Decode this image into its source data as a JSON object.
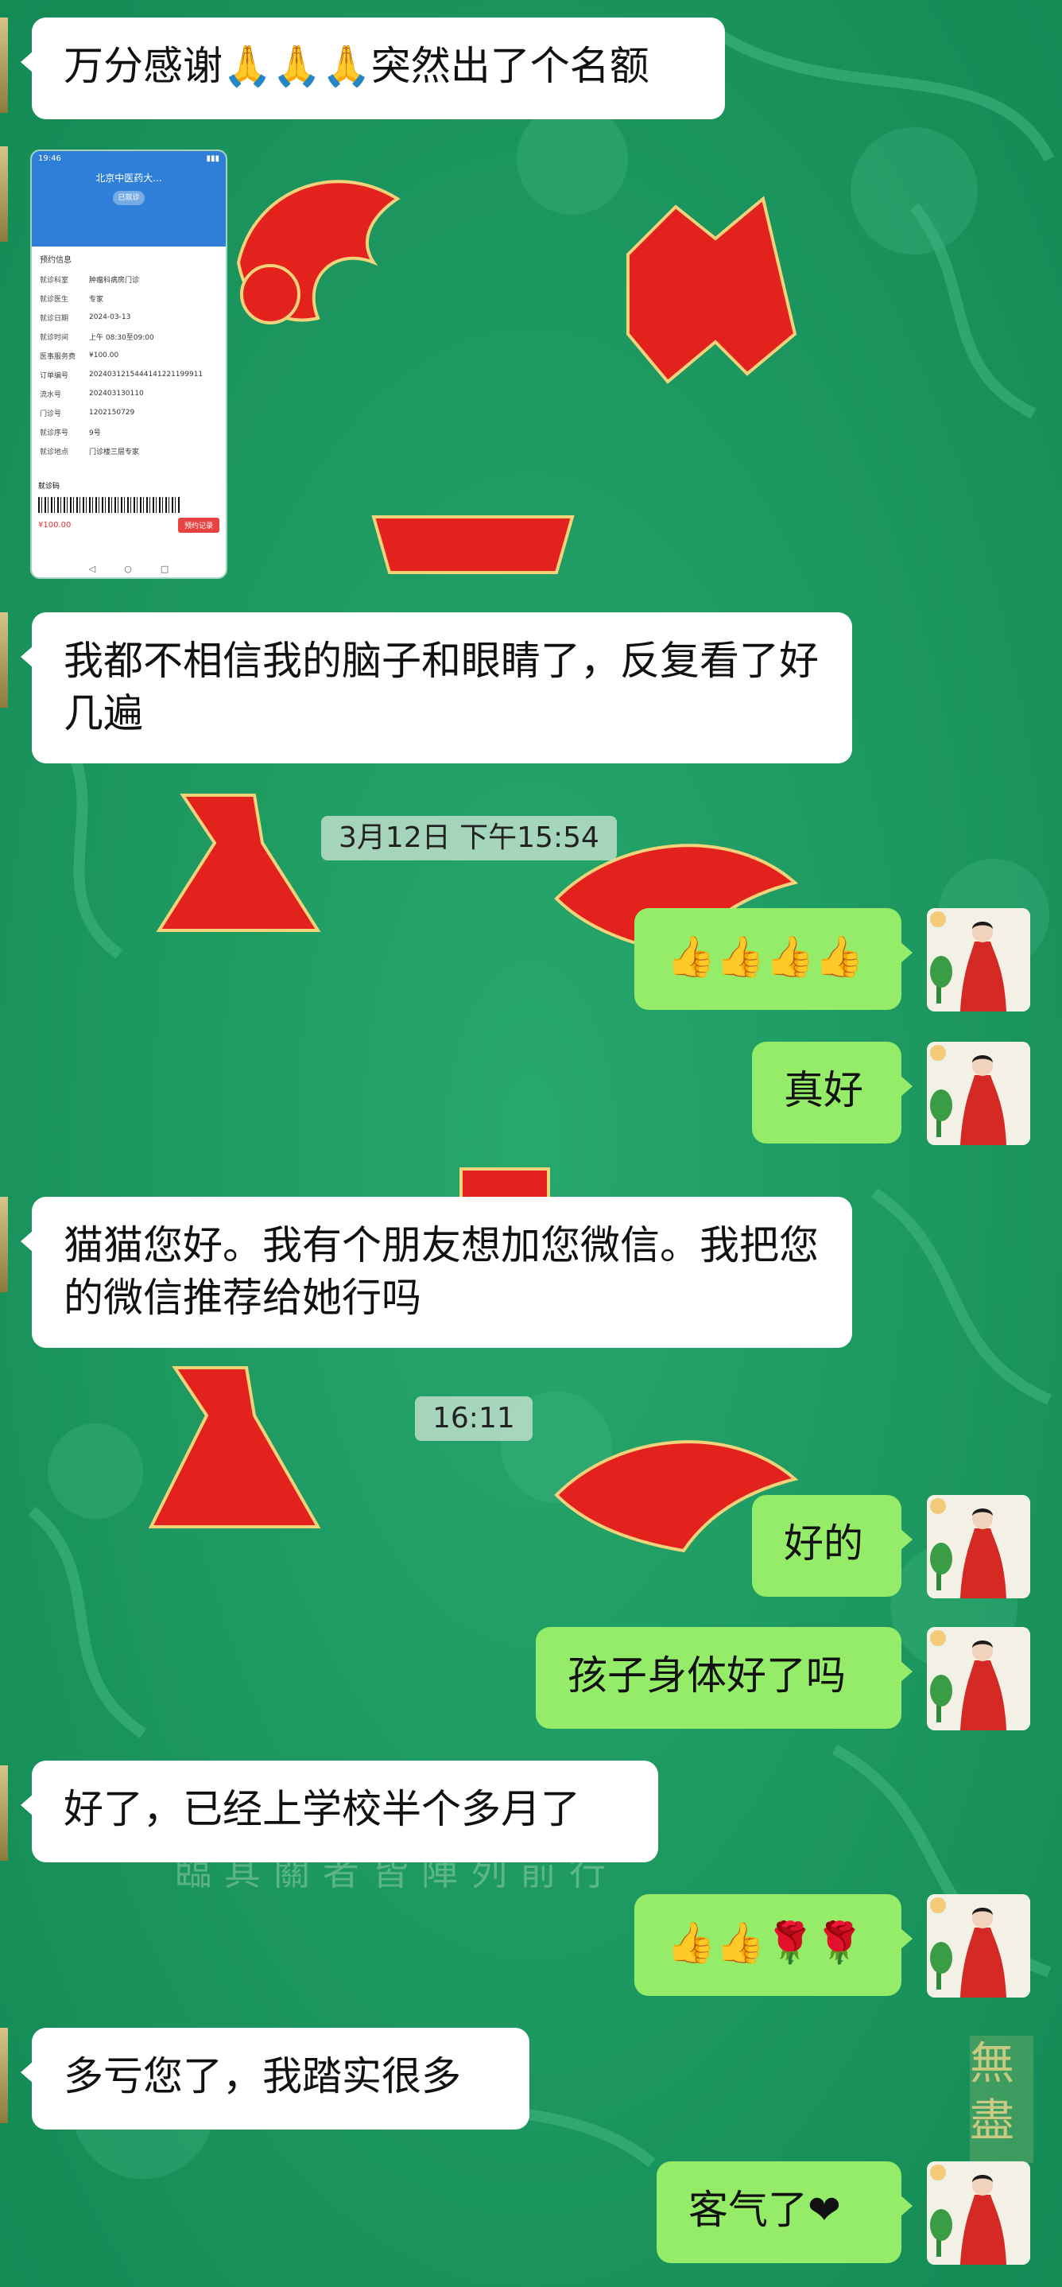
{
  "messages": {
    "m1": "万分感谢🙏🙏🙏突然出了个名额",
    "m2": "我都不相信我的脑子和眼睛了，反复看了好几遍",
    "m3": "👍👍👍👍",
    "m4": "真好",
    "m5": "猫猫您好。我有个朋友想加您微信。我把您的微信推荐给她行吗",
    "m6": "好的",
    "m7": "孩子身体好了吗",
    "m8": "好了，已经上学校半个多月了",
    "m9": "👍👍🌹🌹",
    "m10": "多亏您了，我踏实很多",
    "m11": "客气了❤"
  },
  "timestamps": {
    "t1": "3月12日 下午15:54",
    "t2": "16:11"
  },
  "shared_image": {
    "status_time": "19:46",
    "title": "北京中医药大...",
    "stamp": "已就诊",
    "section": "预约信息",
    "rows": [
      {
        "k": "就诊科室",
        "v": "肿瘤科病房门诊"
      },
      {
        "k": "就诊医生",
        "v": "专家"
      },
      {
        "k": "就诊日期",
        "v": "2024-03-13"
      },
      {
        "k": "就诊时间",
        "v": "上午 08:30至09:00"
      },
      {
        "k": "医事服务费",
        "v": "¥100.00"
      },
      {
        "k": "订单编号",
        "v": "2024031215444141221199911"
      },
      {
        "k": "流水号",
        "v": "202403130110"
      },
      {
        "k": "门诊号",
        "v": "1202150729"
      },
      {
        "k": "就诊序号",
        "v": "9号"
      },
      {
        "k": "就诊地点",
        "v": "门诊楼三层专家"
      }
    ],
    "barcode_label": "就诊码",
    "price": "¥100.00",
    "button": "预约记录",
    "nav": [
      "◁",
      "○",
      "□"
    ]
  },
  "wallpaper_text": {
    "line": "臨其關者皆陣列前行",
    "corner": "無盡"
  },
  "colors": {
    "wallpaper": "#1f9a62",
    "incoming_bubble": "#ffffff",
    "outgoing_bubble": "#95ec69",
    "ornament_red": "#e3221e"
  },
  "icons": {
    "self_avatar": "woman-in-red-hanfu-avatar",
    "peer_avatar": "contact-avatar-thumbnail"
  }
}
